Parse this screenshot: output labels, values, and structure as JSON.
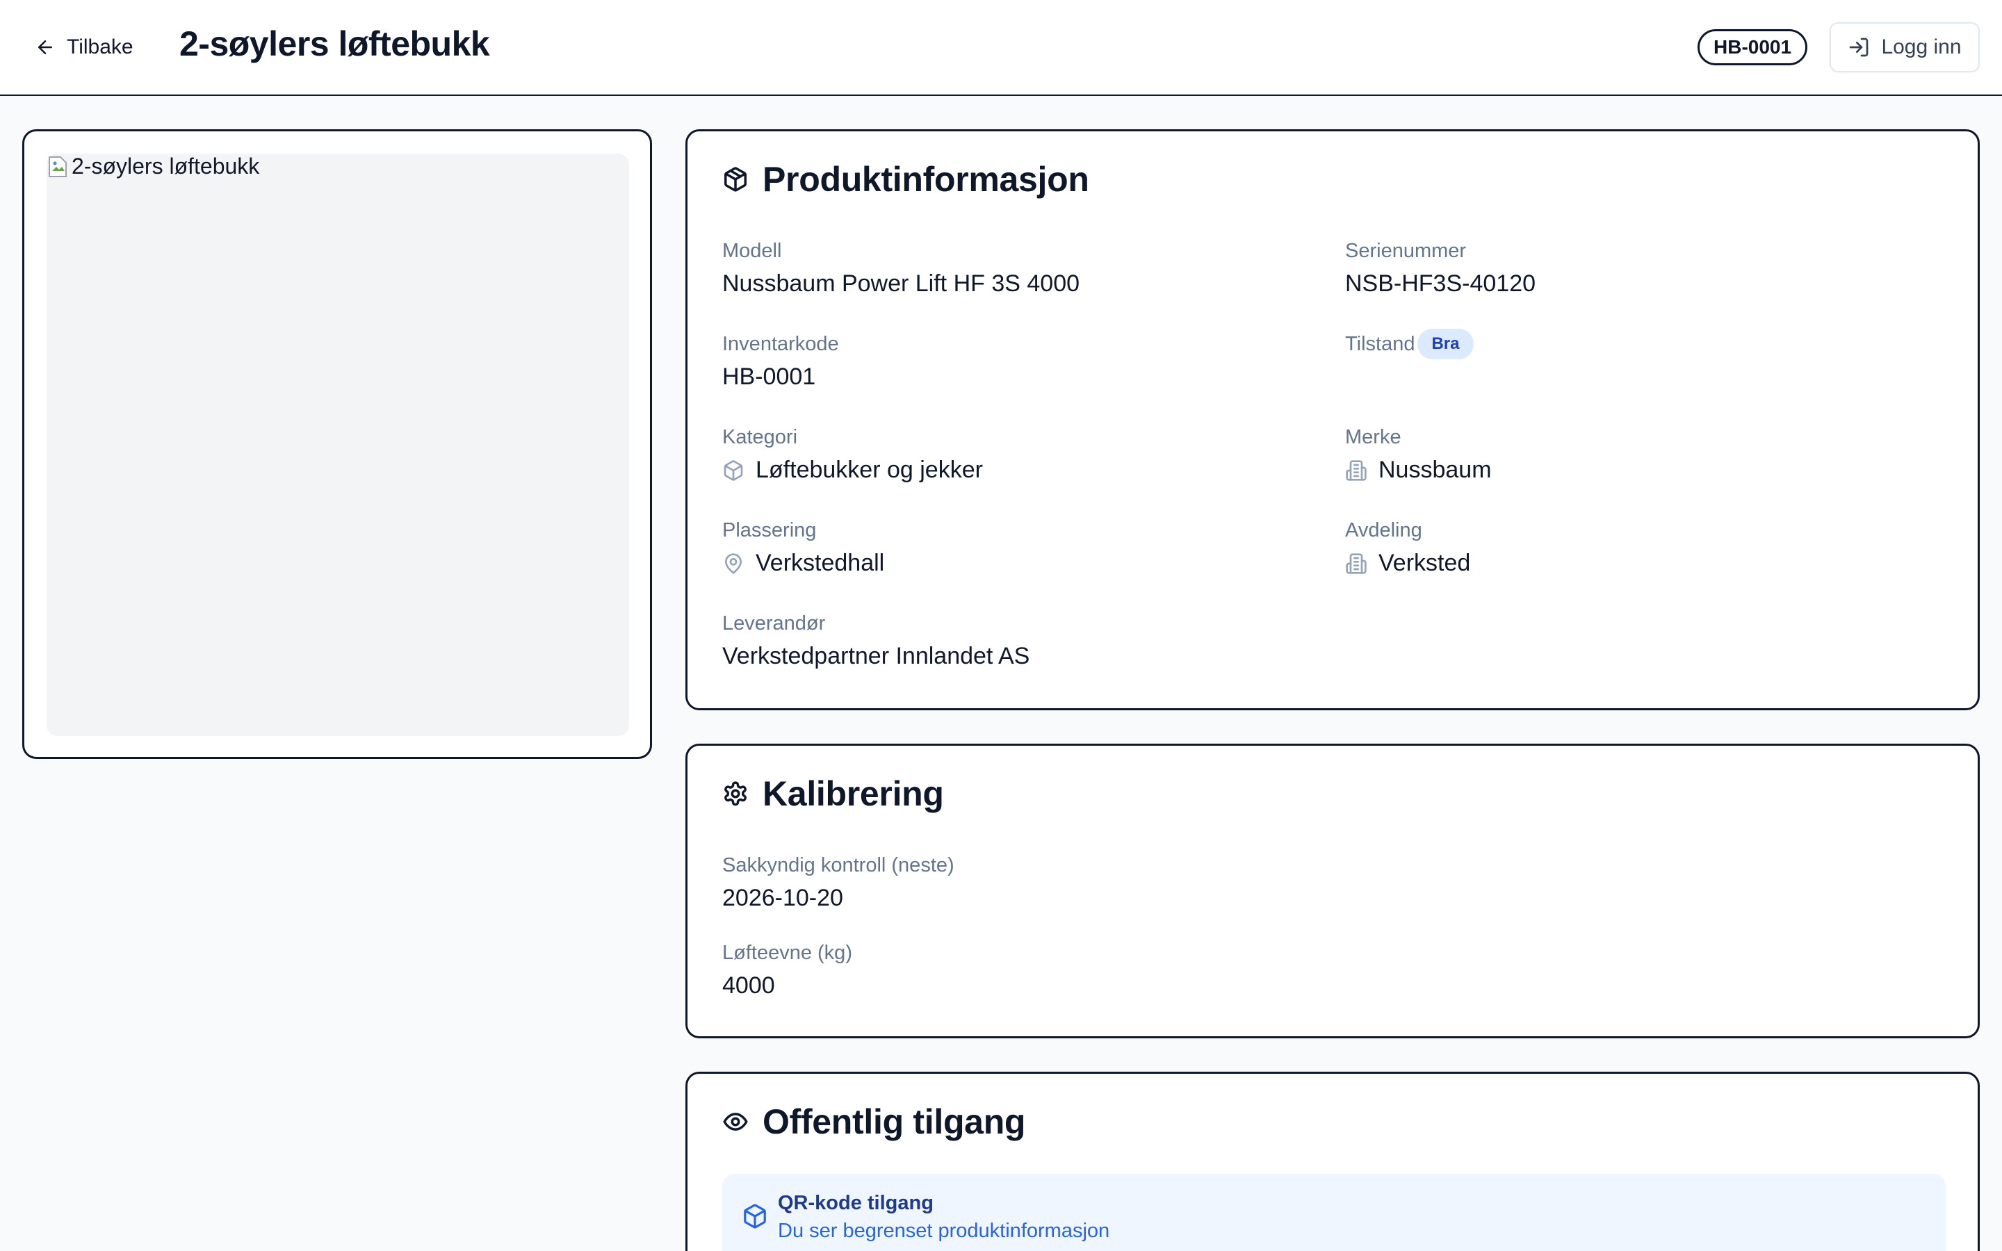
{
  "header": {
    "back_label": "Tilbake",
    "title": "2-søylers løftebukk",
    "inventory_badge": "HB-0001",
    "login_label": "Logg inn"
  },
  "image": {
    "alt_text": "2-søylers løftebukk"
  },
  "product_info": {
    "title": "Produktinformasjon",
    "fields": {
      "model": {
        "label": "Modell",
        "value": "Nussbaum Power Lift HF 3S 4000"
      },
      "serial": {
        "label": "Serienummer",
        "value": "NSB-HF3S-40120"
      },
      "inventory_code": {
        "label": "Inventarkode",
        "value": "HB-0001"
      },
      "condition": {
        "label": "Tilstand",
        "value": "Bra"
      },
      "category": {
        "label": "Kategori",
        "value": "Løftebukker og jekker",
        "icon": "package-icon"
      },
      "brand": {
        "label": "Merke",
        "value": "Nussbaum",
        "icon": "building-icon"
      },
      "location": {
        "label": "Plassering",
        "value": "Verkstedhall",
        "icon": "map-pin-icon"
      },
      "department": {
        "label": "Avdeling",
        "value": "Verksted",
        "icon": "building-icon"
      },
      "supplier": {
        "label": "Leverandør",
        "value": "Verkstedpartner Innlandet AS"
      }
    }
  },
  "calibration": {
    "title": "Kalibrering",
    "fields": {
      "inspection": {
        "label": "Sakkyndig kontroll (neste)",
        "value": "2026-10-20"
      },
      "capacity": {
        "label": "Løfteevne (kg)",
        "value": "4000"
      }
    }
  },
  "public_access": {
    "title": "Offentlig tilgang",
    "qr_title": "QR-kode tilgang",
    "qr_subtitle": "Du ser begrenset produktinformasjon"
  },
  "colors": {
    "border": "#0f172a",
    "label": "#64748b",
    "pill_bg": "#dbeafe",
    "pill_text": "#1e40af",
    "info_bg": "#eff6ff",
    "info_link": "#2563eb"
  }
}
